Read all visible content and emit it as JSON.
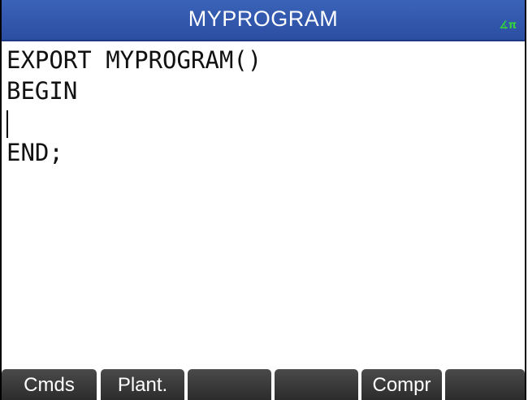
{
  "header": {
    "title": "MYPROGRAM",
    "angle_mode": "∡π"
  },
  "editor": {
    "lines": [
      "EXPORT MYPROGRAM()",
      "BEGIN",
      "",
      "END;"
    ],
    "cursor_line": 3
  },
  "softkeys": [
    {
      "label": "Cmds"
    },
    {
      "label": "Plant."
    },
    {
      "label": ""
    },
    {
      "label": ""
    },
    {
      "label": "Compr"
    },
    {
      "label": ""
    }
  ],
  "colors": {
    "title_bar": "#2b4ea2",
    "angle_indicator": "#34d23c",
    "softkey_bg": "#333333"
  }
}
